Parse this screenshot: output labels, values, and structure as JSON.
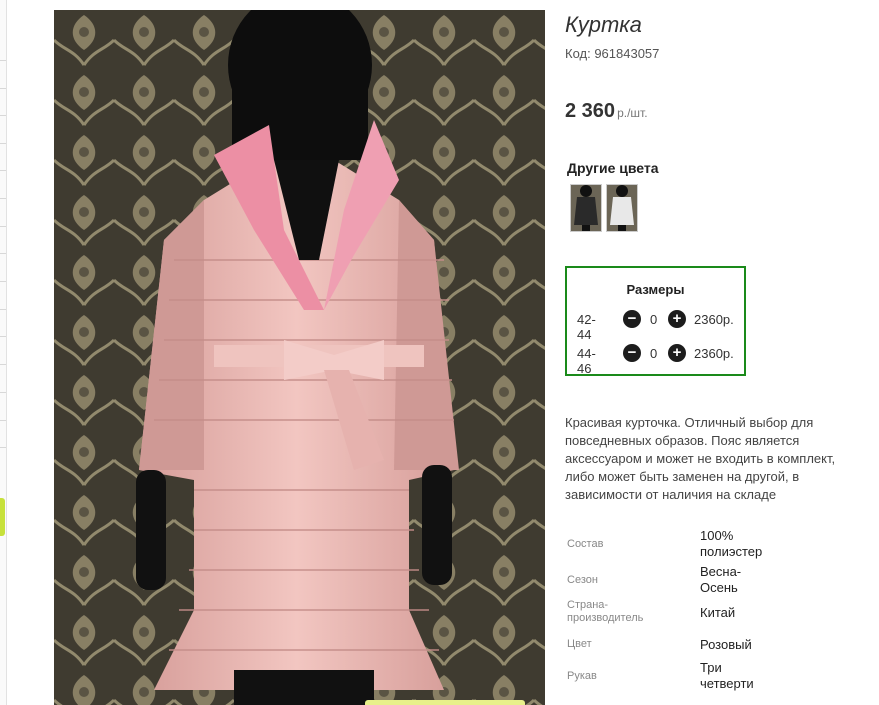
{
  "product": {
    "title": "Куртка",
    "code": "Код: 961843057",
    "price": "2 360",
    "price_unit": "р./шт."
  },
  "other_colors": {
    "title": "Другие цвета",
    "swatches": [
      {
        "name": "black-coat-swatch",
        "color": "#2a2a2a"
      },
      {
        "name": "white-coat-swatch",
        "color": "#e8e8e8"
      }
    ]
  },
  "sizes": {
    "title": "Размеры",
    "rows": [
      {
        "size": "42-44",
        "qty": "0",
        "price": "2360р.",
        "minus": "−",
        "plus": "+"
      },
      {
        "size": "44-46",
        "qty": "0",
        "price": "2360р.",
        "minus": "−",
        "plus": "+"
      }
    ]
  },
  "description": "Красивая курточка. Отличный выбор для повседневных образов. Пояс является аксессуаром и может не входить в комплект, либо может быть заменен на другой, в зависимости от наличия на складе",
  "attributes": [
    {
      "key": "Состав",
      "value": "100% полиэстер"
    },
    {
      "key": "Сезон",
      "value": "Весна-Осень"
    },
    {
      "key": "Страна-производитель",
      "value": "Китай"
    },
    {
      "key": "Цвет",
      "value": "Розовый"
    },
    {
      "key": "Рукав",
      "value": "Три четверти"
    }
  ],
  "colors": {
    "accent_border": "#1a8a1a",
    "coat_pink": "#e8b3b0",
    "collar_pink": "#ec8fa4"
  }
}
